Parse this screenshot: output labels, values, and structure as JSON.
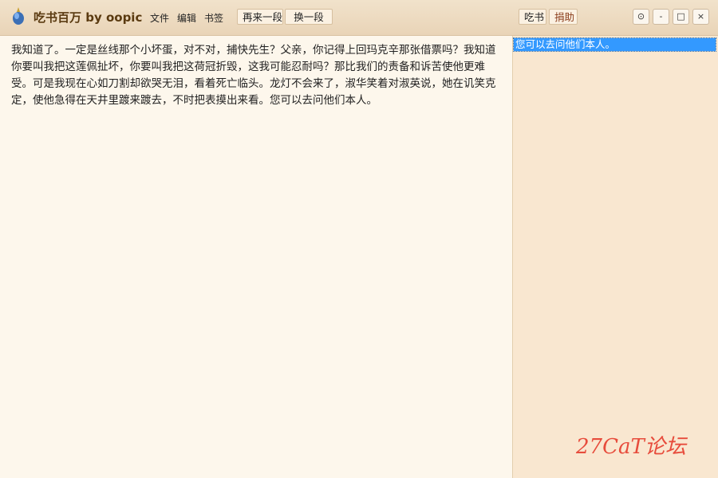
{
  "app": {
    "title": "吃书百万 by oopic"
  },
  "menu": {
    "file": "文件",
    "edit": "编辑",
    "bookmark": "书签"
  },
  "toolbar": {
    "again": "再来一段",
    "switch": "换一段"
  },
  "right_toolbar": {
    "eat": "吃书",
    "donate": "捐助"
  },
  "window_controls": {
    "options": "⊙",
    "minimize": "-",
    "maximize": "□",
    "close": "×"
  },
  "reading": {
    "text": "我知道了。一定是丝线那个小坏蛋，对不对，捕快先生？父亲，你记得上回玛克辛那张借票吗？我知道你要叫我把这莲佩扯坏，你要叫我把这荷冠折毁，这我可能忍耐吗？那比我们的责备和诉苦使他更难受。可是我现在心如刀割却欲哭无泪，看着死亡临头。龙灯不会来了，淑华笑着对淑英说，她在讥笑克定，使他急得在天井里踱来踱去，不时把表摸出来看。您可以去问他们本人。"
  },
  "sidebar": {
    "items": [
      {
        "label": "您可以去问他们本人。"
      }
    ]
  },
  "watermark": "27CaT论坛",
  "colors": {
    "highlight": "#3399ff",
    "title_text": "#5a3a10",
    "watermark": "#e74c3c"
  }
}
